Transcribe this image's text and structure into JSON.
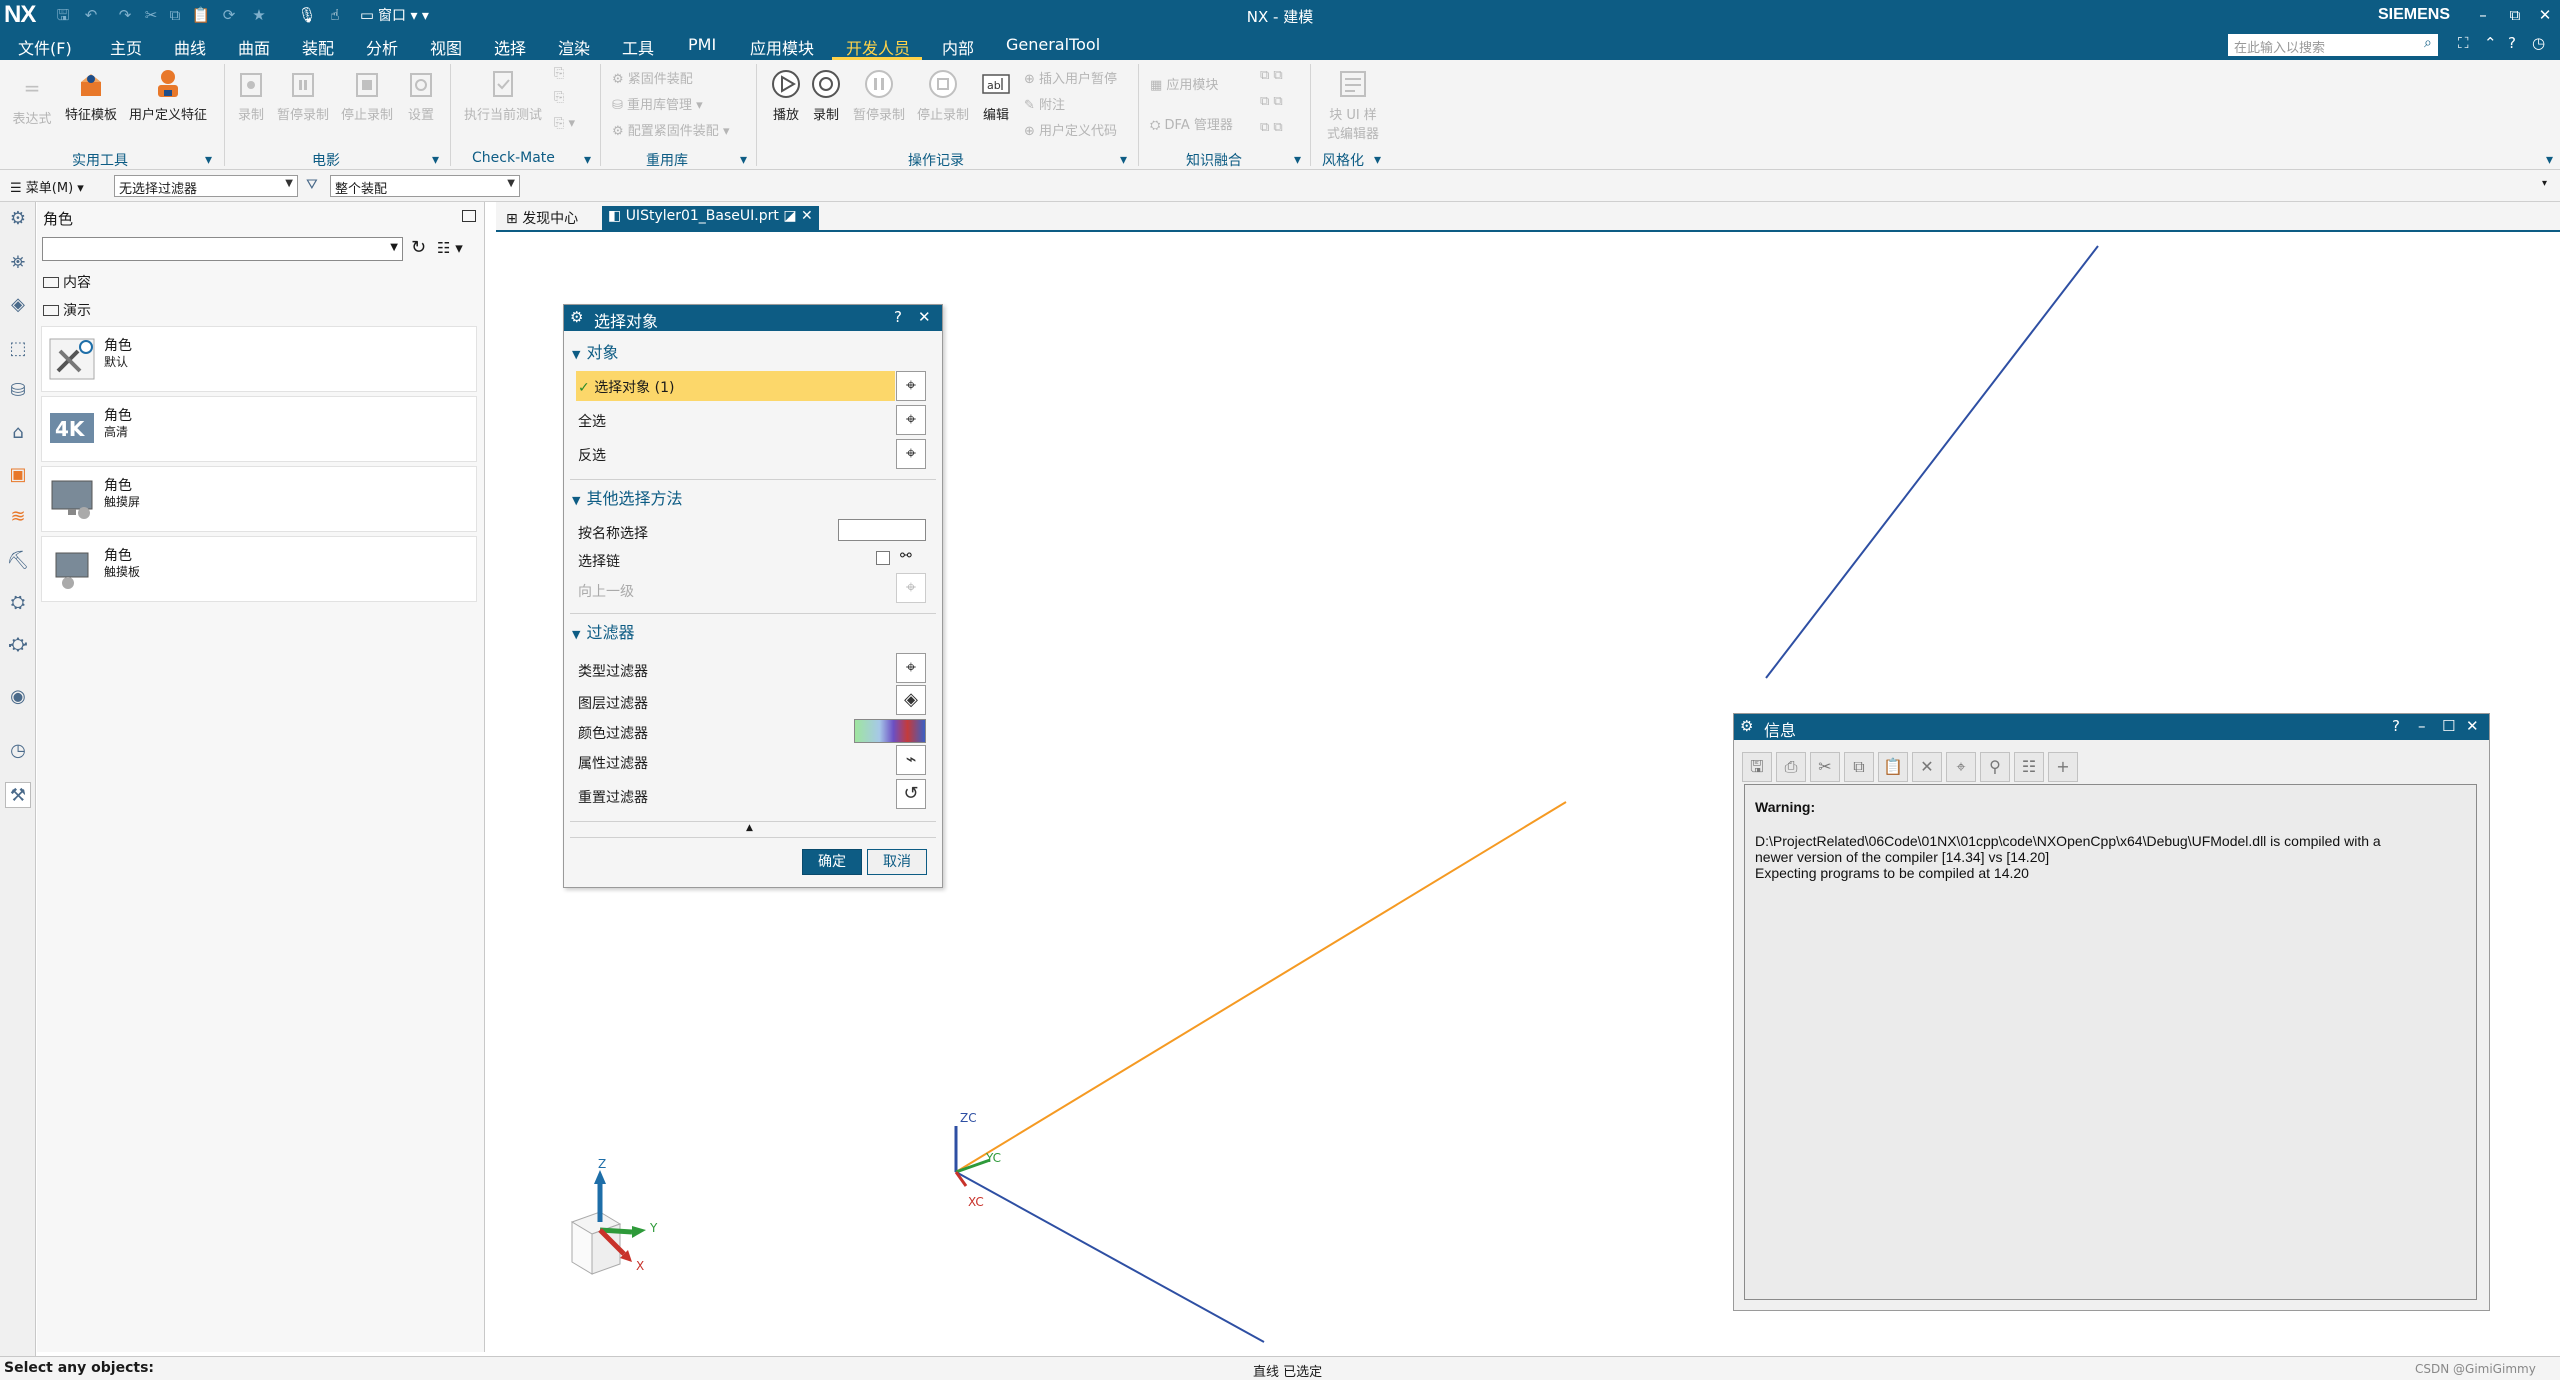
{
  "titlebar": {
    "logo": "NX",
    "window_menu": "窗口",
    "title": "NX - 建模",
    "brand": "SIEMENS",
    "min_glyph": "–",
    "restore_glyph": "⧉",
    "close_glyph": "✕"
  },
  "menubar": {
    "items": [
      "文件(F)",
      "主页",
      "曲线",
      "曲面",
      "装配",
      "分析",
      "视图",
      "选择",
      "渲染",
      "工具",
      "PMI",
      "应用模块",
      "开发人员",
      "内部",
      "GeneralTool"
    ],
    "active_index": 12,
    "search_placeholder": "在此输入以搜索"
  },
  "ribbon": {
    "utility": {
      "expression": "表达式",
      "feature_template": "特征模板",
      "user_feature": "用户定义特征",
      "group_label": "实用工具"
    },
    "movie": {
      "record": "录制",
      "pause_record": "暂停录制",
      "stop_record": "停止录制",
      "settings": "设置",
      "group_label": "电影"
    },
    "checkmate": {
      "run_test": "执行当前测试",
      "group_label": "Check-Mate"
    },
    "reuse": {
      "fastener": "紧固件装配",
      "library": "重用库管理",
      "config_fastener": "配置紧固件装配",
      "group_label": "重用库"
    },
    "journal": {
      "play": "播放",
      "record": "录制",
      "pause": "暂停录制",
      "stop": "停止录制",
      "edit": "编辑",
      "insert_pause": "插入用户暂停",
      "comment": "附注",
      "user_code": "用户定义代码",
      "group_label": "操作记录"
    },
    "knowledge": {
      "app_module": "应用模块",
      "dfa_manager": "DFA 管理器",
      "group_label": "知识融合"
    },
    "styler": {
      "block_ui_line1": "块 UI 样",
      "block_ui_line2": "式编辑器",
      "group_label": "风格化"
    }
  },
  "toolbar": {
    "menu_label": "菜单(M)",
    "filter_value": "无选择过滤器",
    "scope_value": "整个装配"
  },
  "navigator": {
    "title": "角色",
    "tree": [
      "内容",
      "演示"
    ],
    "roles": [
      {
        "name": "角色",
        "desc": "默认"
      },
      {
        "name": "角色",
        "desc": "高清"
      },
      {
        "name": "角色",
        "desc": "触摸屏"
      },
      {
        "name": "角色",
        "desc": "触摸板"
      }
    ]
  },
  "tabs": {
    "discovery": "发现中心",
    "part": "UIStyler01_BaseUI.prt"
  },
  "select_dialog": {
    "title": "选择对象",
    "section_object": "对象",
    "select_object": "选择对象 (1)",
    "select_all": "全选",
    "invert": "反选",
    "section_other": "其他选择方法",
    "by_name": "按名称选择",
    "chain": "选择链",
    "up_one_level": "向上一级",
    "section_filter": "过滤器",
    "type_filter": "类型过滤器",
    "layer_filter": "图层过滤器",
    "color_filter": "颜色过滤器",
    "attribute_filter": "属性过滤器",
    "reset_filter": "重置过滤器",
    "ok": "确定",
    "cancel": "取消"
  },
  "info_dialog": {
    "title": "信息",
    "warning": "Warning:",
    "line1": "D:\\ProjectRelated\\06Code\\01NX\\01cpp\\code\\NXOpenCpp\\x64\\Debug\\UFModel.dll is compiled with a",
    "line2": "newer version of the compiler [14.34] vs [14.20]",
    "line3": "Expecting programs to be compiled at 14.20"
  },
  "triad": {
    "zc": "ZC",
    "yc": "YC",
    "xc": "XC",
    "z": "Z",
    "y": "Y",
    "x": "X"
  },
  "status": {
    "prompt": "Select any objects:",
    "selection": "直线 已选定",
    "watermark": "CSDN @GimiGimmy"
  },
  "colors": {
    "brand": "#0d5c84",
    "active_tab": "#ffd24a",
    "highlight": "#fcd76a",
    "orange_line": "#f59a23",
    "blue_line": "#2e4fa3"
  }
}
